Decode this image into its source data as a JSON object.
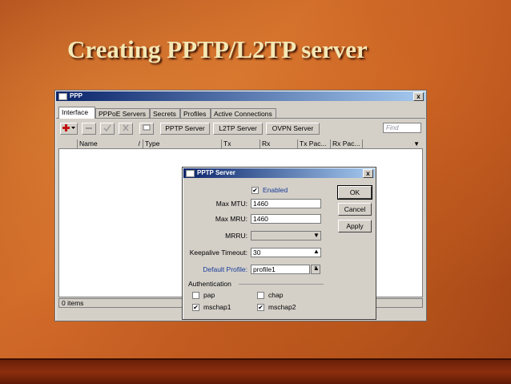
{
  "slide": {
    "title": "Creating PPTP/L2TP server"
  },
  "ppp_window": {
    "title": "PPP",
    "tabs": [
      "Interface",
      "PPPoE Servers",
      "Secrets",
      "Profiles",
      "Active Connections"
    ],
    "active_tab": "Interface",
    "toolbar": {
      "add_icon": "plus-icon",
      "remove_icon": "minus-icon",
      "enable_icon": "check-icon",
      "disable_icon": "x-icon",
      "comment_icon": "comment-icon",
      "pptp_server": "PPTP Server",
      "l2tp_server": "L2TP Server",
      "ovpn_server": "OVPN Server",
      "find_placeholder": "Find"
    },
    "columns": [
      "Name",
      "Type",
      "Tx",
      "Rx",
      "Tx Pac...",
      "Rx Pac..."
    ],
    "status": "0 items"
  },
  "pptp_dialog": {
    "title": "PPTP Server",
    "enabled_label": "Enabled",
    "enabled": true,
    "max_mtu_label": "Max MTU:",
    "max_mtu": "1460",
    "max_mru_label": "Max MRU:",
    "max_mru": "1460",
    "mrru_label": "MRRU:",
    "mrru": "",
    "keepalive_label": "Keepalive Timeout:",
    "keepalive": "30",
    "default_profile_label": "Default Profile:",
    "default_profile": "profile1",
    "auth_label": "Authentication",
    "auth": {
      "pap": "pap",
      "pap_checked": false,
      "chap": "chap",
      "chap_checked": false,
      "mschap1": "mschap1",
      "mschap1_checked": true,
      "mschap2": "mschap2",
      "mschap2_checked": true
    },
    "buttons": {
      "ok": "OK",
      "cancel": "Cancel",
      "apply": "Apply"
    },
    "close_label": "x"
  },
  "colors": {
    "title_text": "#f4e7b4",
    "titlebar": "#0a246a",
    "link_label": "#1a3c9a"
  }
}
